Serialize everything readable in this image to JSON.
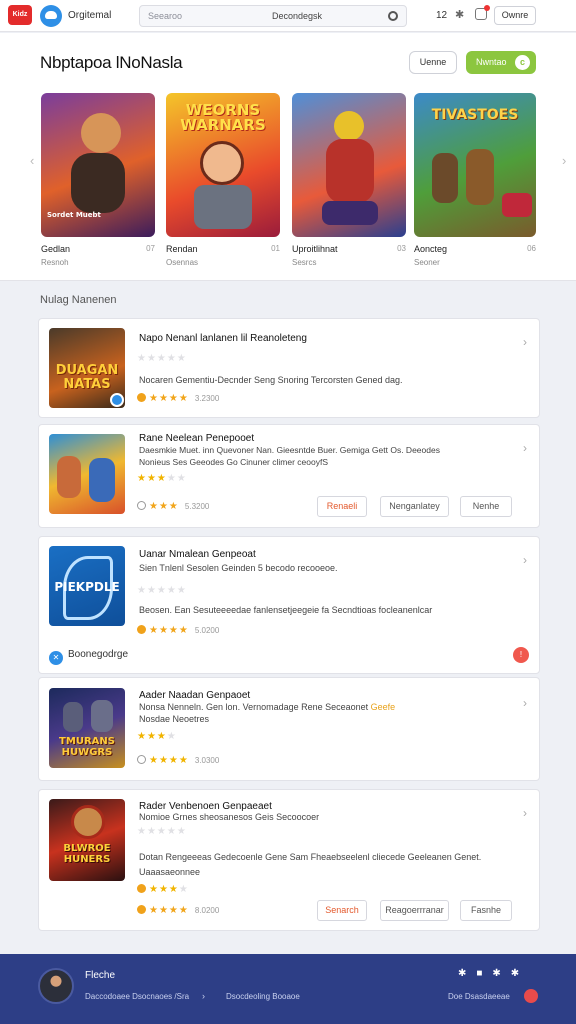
{
  "topbar": {
    "logo_text": "Kidz",
    "brand": "Orgitemal",
    "search_placeholder": "Seearoo",
    "search_value": "Decondegsk",
    "count": "12",
    "account_button": "Ownre"
  },
  "featured": {
    "title": "Nbptapoa lNoNasla",
    "btn_outline": "Uenne",
    "btn_green": "Nwntao",
    "cards": [
      {
        "art_text": "Sordet Muebt",
        "name": "Gedlan",
        "count": "07",
        "sub": "Resnoh"
      },
      {
        "art_text": "WEORNS WARNARS",
        "name": "Rendan",
        "count": "01",
        "sub": "Osennas"
      },
      {
        "art_text": "",
        "name": "Uproitlihnat",
        "count": "03",
        "sub": "Sesrcs"
      },
      {
        "art_text": "TIVASTOES",
        "name": "Aoncteg",
        "count": "06",
        "sub": "Seoner"
      }
    ]
  },
  "list": {
    "heading": "Nulag Nanenen",
    "rows": [
      {
        "art_text": "DUAGAN NATAS",
        "title": "Napo Nenanl lanlanen lil Reanoleteng",
        "line1": "Nocaren Gementiu-Decnder Seng Snoring Tercorsten Gened dag.",
        "line2": "",
        "line3": "",
        "score": "3.2300",
        "buttons": []
      },
      {
        "art_text": "",
        "title": "Rane Neelean Penepooet",
        "line1": "Daesmkie Muet. inn Quevoner Nan. Gieesntde Buer. Gemiga Gett Os. Deeodes",
        "line2": "Nonieus Ses Geeodes Go Cinuner climer ceooyfS",
        "line3": "",
        "score": "5.3200",
        "buttons": [
          "Renaeli",
          "Nenganlatey",
          "Nenhe"
        ]
      },
      {
        "art_text": "PIEKPDLE",
        "title": "Uanar Nmalean Genpeoat",
        "line1": "Sien Tnlenl Sesolen Geinden 5 becodo recooeoe.",
        "line2": "Beosen. Ean Sesuteeeedae fanlensetjeegeie fa Secndtioas focleanenlcar",
        "line3": "",
        "score": "5.0200",
        "developer": "Boonegodrge",
        "buttons": []
      },
      {
        "art_text": "TMURANS HUWGRS",
        "title": "Aader Naadan Genpaoet",
        "line1": "Nonsa Nenneln. Gen lon. Vernomadage Rene Seceaonet ",
        "line1_hl": "Geefe",
        "line2": "Nosdae Neoetres",
        "line3": "",
        "score": "3.0300",
        "buttons": []
      },
      {
        "art_text": "BLWROE HUNERS",
        "title": "Rader Venbenoen Genpaeaet",
        "line1": "Nomioe Grnes sheosanesos Geis Secoocoer",
        "line2": "Dotan Rengeeeas Gedecoenle Gene Sam Fheaebseelenl cliecede Geeleanen Genet.",
        "line3": "Uaaasaeonnee",
        "score": "8.0200",
        "buttons": [
          "Senarch",
          "Reagoerrranar",
          "Fasnhe"
        ]
      }
    ]
  },
  "footer": {
    "name": "Fleche",
    "links": "Daccodoaee Dsocnaoes /Sra",
    "sep": "›",
    "mid": "Dsocdeoling  Booaoe",
    "right": "Doe Dsasdaeeae"
  }
}
